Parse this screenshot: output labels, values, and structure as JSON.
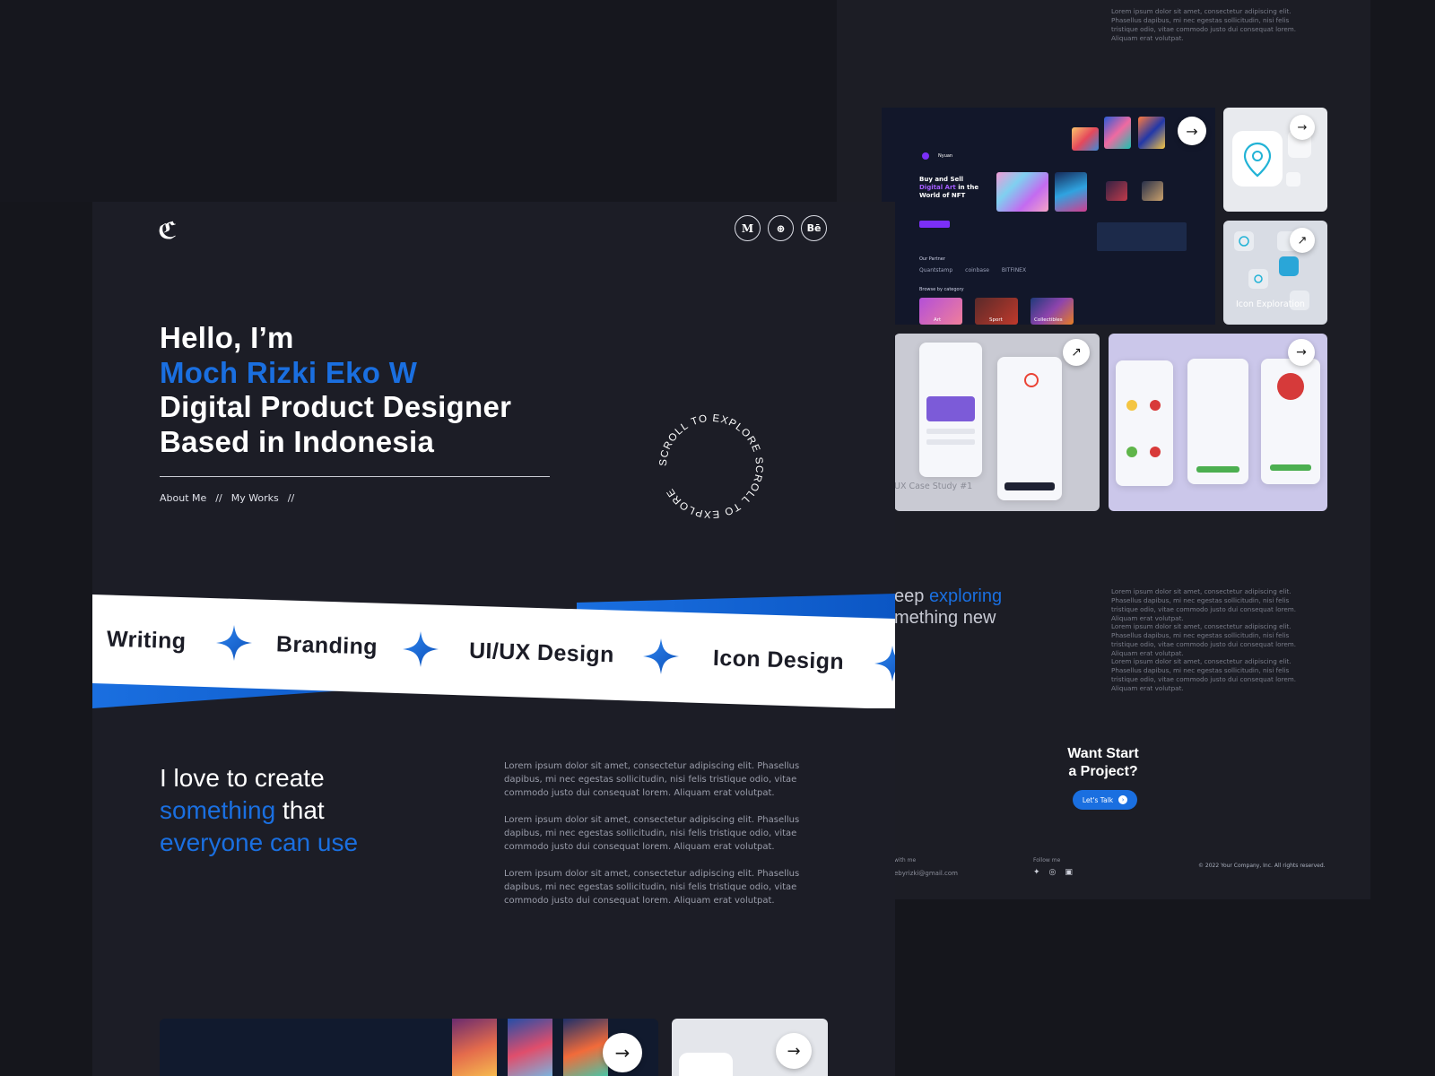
{
  "colors": {
    "accent": "#1a6fe0",
    "background": "#15161c",
    "panel": "#1c1d26",
    "ribbon": "#ffffff",
    "nft_purple": "#7b2ff7"
  },
  "right_panel": {
    "lorem_top": "Lorem ipsum dolor sit amet, consectetur adipiscing elit. Phasellus dapibus, mi nec egestas sollicitudin, nisi felis tristique odio, vitae commodo justo dui consequat lorem. Aliquam erat volutpat.",
    "cards": {
      "nft": {
        "brand": "Nyuan",
        "title_pre": "Buy and Sell",
        "title_accent": "Digital Art",
        "title_post": "in the World of NFT",
        "partner_label": "Our Partner",
        "partners": [
          "Quantstamp",
          "coinbase",
          "BITFINEX"
        ],
        "browse_label": "Browse by category",
        "categories": [
          "Art",
          "Sport",
          "Collectibles"
        ],
        "arrow_icon": "arrow-right-icon"
      },
      "icon_card_1": {
        "arrow_icon": "arrow-right-icon"
      },
      "icon_card_2": {
        "label": "Icon Exploration",
        "arrow_icon": "arrow-up-right-icon"
      },
      "ux1": {
        "label": "UX Case Study #1",
        "arrow_icon": "arrow-up-right-icon"
      },
      "ux2": {
        "arrow_icon": "arrow-right-icon"
      }
    },
    "keep_exploring": {
      "line1_pre": "eep",
      "line1_accent": "exploring",
      "line2": "mething new"
    },
    "lorem_blocks": [
      "Lorem ipsum dolor sit amet, consectetur adipiscing elit. Phasellus dapibus, mi nec egestas sollicitudin, nisi felis tristique odio, vitae commodo justo dui consequat lorem. Aliquam erat volutpat.",
      "Lorem ipsum dolor sit amet, consectetur adipiscing elit. Phasellus dapibus, mi nec egestas sollicitudin, nisi felis tristique odio, vitae commodo justo dui consequat lorem. Aliquam erat volutpat.",
      "Lorem ipsum dolor sit amet, consectetur adipiscing elit. Phasellus dapibus, mi nec egestas sollicitudin, nisi felis tristique odio, vitae commodo justo dui consequat lorem. Aliquam erat volutpat."
    ],
    "cta": {
      "line1": "Want Start",
      "line2": "a Project?",
      "button": "Let's Talk"
    },
    "footer": {
      "contact_label": "with me",
      "email": "ebyrizki@gmail.com",
      "follow_label": "Follow me",
      "social_icons": [
        "twitter-icon",
        "instagram-icon",
        "linkedin-icon"
      ],
      "copyright": "© 2022 Your Company, Inc. All rights reserved."
    }
  },
  "main": {
    "logo": "ℭ",
    "social_buttons": [
      {
        "icon": "medium-icon",
        "glyph": "M"
      },
      {
        "icon": "dribbble-icon",
        "glyph": "⊛"
      },
      {
        "icon": "behance-icon",
        "glyph": "Bē"
      }
    ],
    "hero": {
      "line1": "Hello, I’m",
      "name": "Moch Rizki Eko W",
      "line3": "Digital Product Designer",
      "line4": "Based in Indonesia"
    },
    "links": [
      "About Me",
      "My Works"
    ],
    "link_separator": "//",
    "scroll_text": "SCROLL TO EXPLORE SCROLL TO EXPLORE ",
    "ribbon": [
      "Writing",
      "Branding",
      "UI/UX Design",
      "Icon Design"
    ],
    "love": {
      "line1": "I love to create",
      "line2_accent": "something",
      "line2_post": " that",
      "line3_accent": "everyone can use"
    },
    "lorem_blocks": [
      "Lorem ipsum dolor sit amet, consectetur adipiscing elit. Phasellus dapibus, mi nec egestas sollicitudin, nisi felis tristique odio, vitae commodo justo dui consequat lorem. Aliquam erat volutpat.",
      "Lorem ipsum dolor sit amet, consectetur adipiscing elit. Phasellus dapibus, mi nec egestas sollicitudin, nisi felis tristique odio, vitae commodo justo dui consequat lorem. Aliquam erat volutpat.",
      "Lorem ipsum dolor sit amet, consectetur adipiscing elit. Phasellus dapibus, mi nec egestas sollicitudin, nisi felis tristique odio, vitae commodo justo dui consequat lorem. Aliquam erat volutpat."
    ],
    "arrow_glyph": "→",
    "arrow_diag_glyph": "↗"
  }
}
